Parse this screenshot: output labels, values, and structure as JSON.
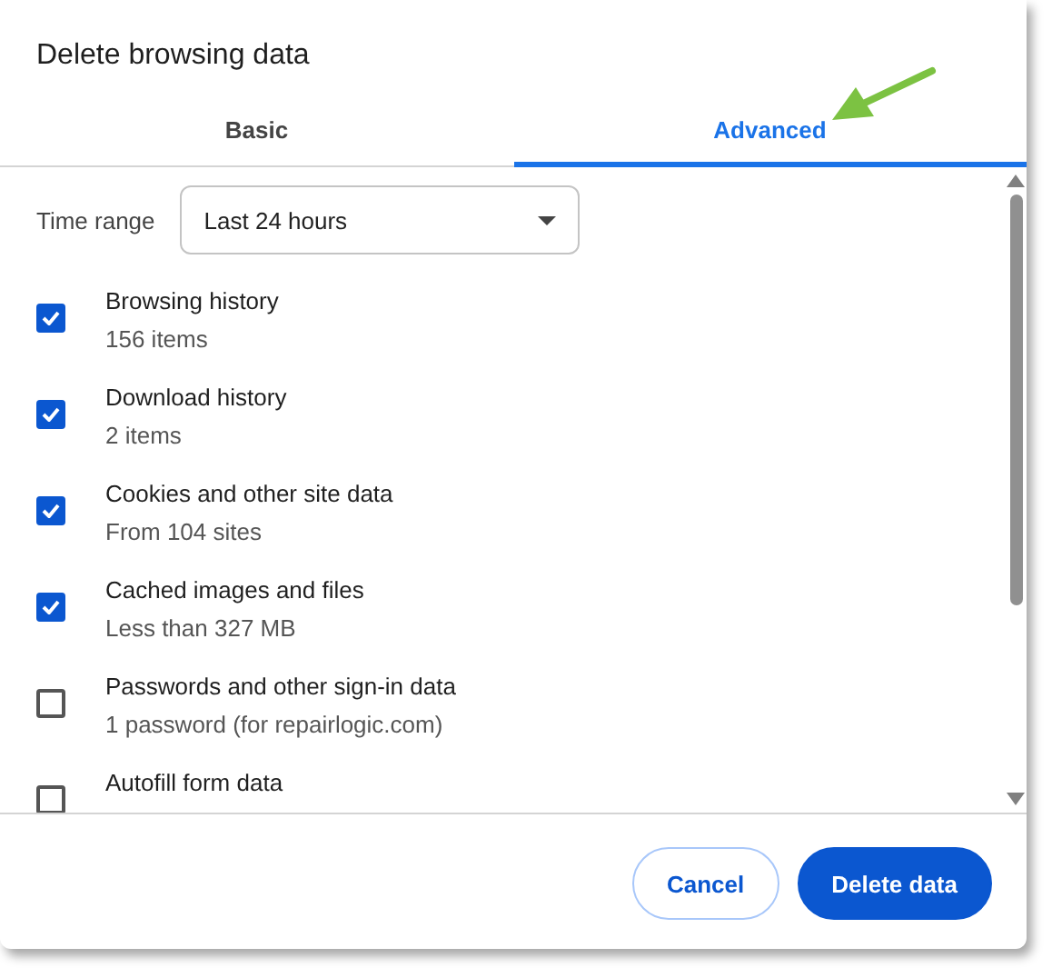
{
  "dialog": {
    "title": "Delete browsing data"
  },
  "tabs": [
    {
      "label": "Basic",
      "selected": false
    },
    {
      "label": "Advanced",
      "selected": true
    }
  ],
  "time_range": {
    "label": "Time range",
    "value": "Last 24 hours"
  },
  "items": [
    {
      "label": "Browsing history",
      "detail": "156 items",
      "checked": true
    },
    {
      "label": "Download history",
      "detail": "2 items",
      "checked": true
    },
    {
      "label": "Cookies and other site data",
      "detail": "From 104 sites",
      "checked": true
    },
    {
      "label": "Cached images and files",
      "detail": "Less than 327 MB",
      "checked": true
    },
    {
      "label": "Passwords and other sign-in data",
      "detail": "1 password (for repairlogic.com)",
      "checked": false
    },
    {
      "label": "Autofill form data",
      "checked": false
    }
  ],
  "buttons": [
    {
      "label": "Cancel",
      "kind": "secondary"
    },
    {
      "label": "Delete data",
      "kind": "primary"
    }
  ]
}
